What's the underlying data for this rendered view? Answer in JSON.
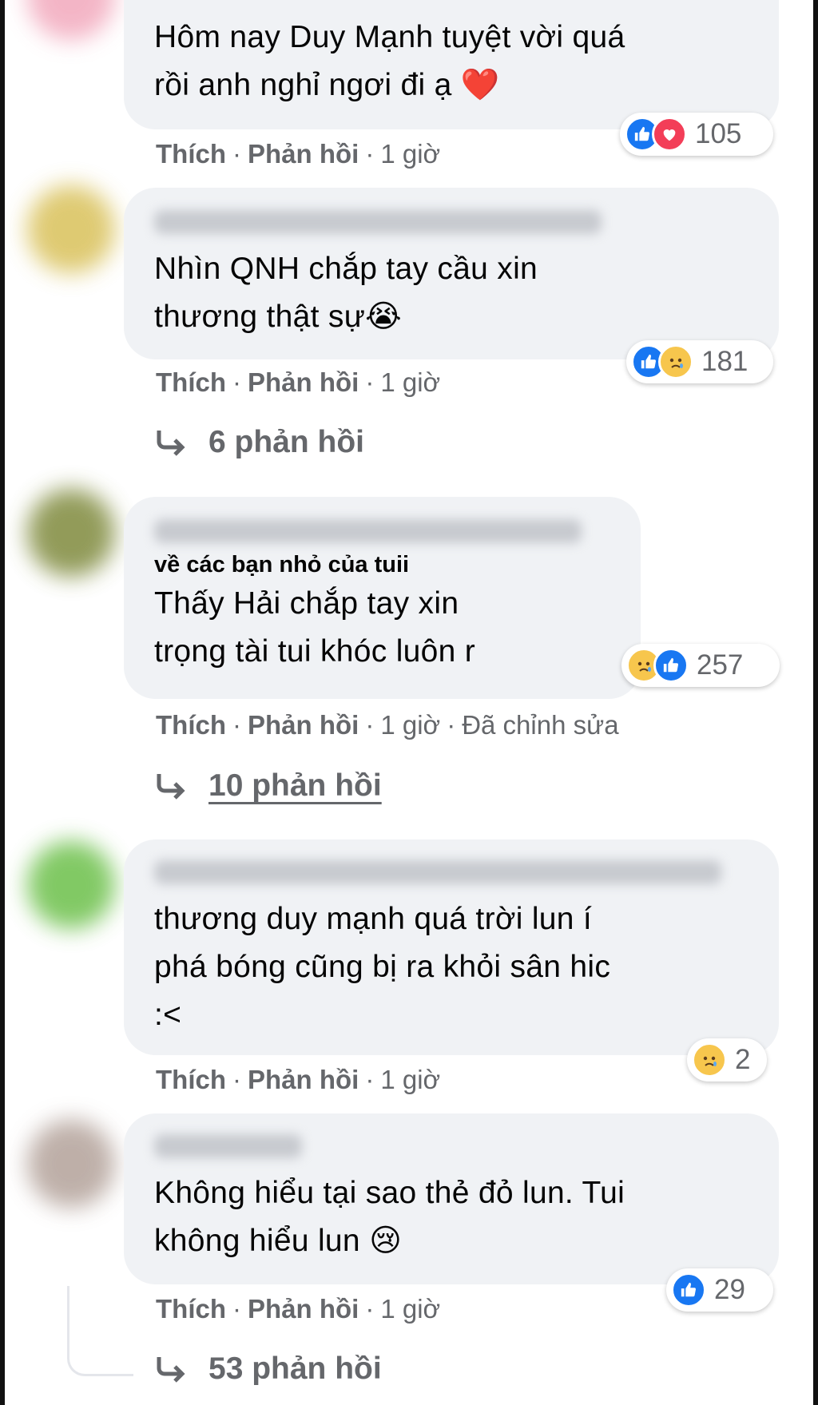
{
  "comments": [
    {
      "text": "Hôm nay Duy Mạnh tuyệt vời quá\nrồi anh nghỉ ngơi đi ạ",
      "emoji": "❤️",
      "reactions": [
        "like",
        "love"
      ],
      "reaction_count": "105",
      "actions": {
        "like": "Thích",
        "reply": "Phản hồi",
        "time": "1 giờ"
      }
    },
    {
      "text": "Nhìn QNH chắp tay cầu xin\nthương thật sự",
      "emoji": "😭",
      "reactions": [
        "like",
        "sad"
      ],
      "reaction_count": "181",
      "actions": {
        "like": "Thích",
        "reply": "Phản hồi",
        "time": "1 giờ"
      },
      "replies_label": "6 phản hồi"
    },
    {
      "subline": "về các bạn nhỏ của tuii",
      "text": "Thấy Hải chắp tay xin\ntrọng tài tui khóc luôn r",
      "reactions": [
        "sad",
        "like"
      ],
      "reaction_count": "257",
      "actions": {
        "like": "Thích",
        "reply": "Phản hồi",
        "time": "1 giờ",
        "edited": "Đã chỉnh sửa"
      },
      "replies_label": "10 phản hồi"
    },
    {
      "text": "thương duy mạnh quá trời lun í\nphá bóng cũng bị ra khỏi sân hic\n:<",
      "reactions": [
        "sad"
      ],
      "reaction_count": "2",
      "actions": {
        "like": "Thích",
        "reply": "Phản hồi",
        "time": "1 giờ"
      }
    },
    {
      "text": "Không hiểu tại sao thẻ đỏ lun. Tui\nkhông hiểu lun",
      "emoji": "😢",
      "reactions": [
        "like"
      ],
      "reaction_count": "29",
      "actions": {
        "like": "Thích",
        "reply": "Phản hồi",
        "time": "1 giờ"
      },
      "replies_label": "53 phản hồi"
    }
  ],
  "separator": "·",
  "colors": {
    "bubble": "#f0f2f5",
    "meta": "#65676b",
    "like": "#1877f2",
    "love": "#f33e58",
    "sad": "#f7c64d"
  }
}
